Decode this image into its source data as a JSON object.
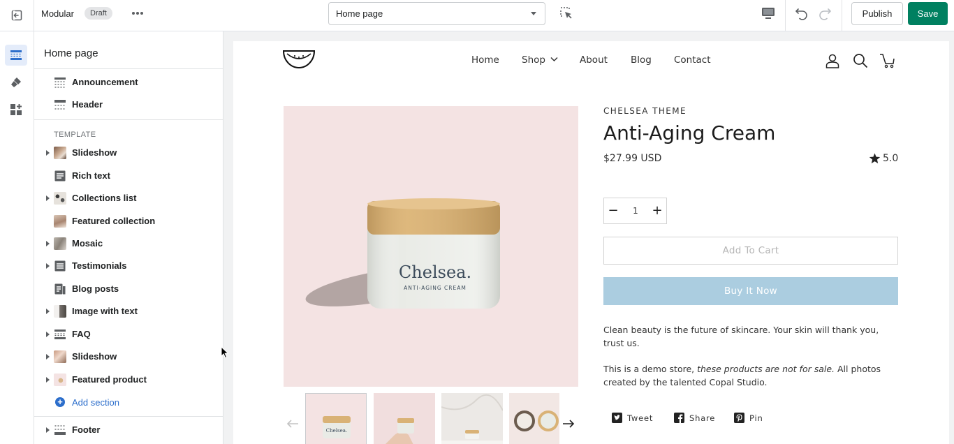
{
  "topbar": {
    "theme_name": "Modular",
    "status_badge": "Draft",
    "page_select": "Home page",
    "publish_label": "Publish",
    "save_label": "Save",
    "save_color": "#008060"
  },
  "rail": {
    "items": [
      {
        "icon": "sections-icon",
        "active": true
      },
      {
        "icon": "theme-settings-icon",
        "active": false
      },
      {
        "icon": "app-embeds-icon",
        "active": false
      }
    ]
  },
  "panel": {
    "title": "Home page",
    "header_sections": [
      {
        "label": "Announcement",
        "icon": "announcement-bar-icon"
      },
      {
        "label": "Header",
        "icon": "header-icon"
      }
    ],
    "template_label": "TEMPLATE",
    "template_sections": [
      {
        "label": "Slideshow",
        "expandable": true,
        "icon": "slideshow-thumb"
      },
      {
        "label": "Rich text",
        "expandable": false,
        "icon": "rich-text-icon"
      },
      {
        "label": "Collections list",
        "expandable": true,
        "icon": "collections-list-thumb"
      },
      {
        "label": "Featured collection",
        "expandable": false,
        "icon": "featured-collection-thumb"
      },
      {
        "label": "Mosaic",
        "expandable": true,
        "icon": "mosaic-thumb"
      },
      {
        "label": "Testimonials",
        "expandable": true,
        "icon": "testimonials-icon"
      },
      {
        "label": "Blog posts",
        "expandable": false,
        "icon": "blog-posts-icon"
      },
      {
        "label": "Image with text",
        "expandable": true,
        "icon": "image-with-text-thumb"
      },
      {
        "label": "FAQ",
        "expandable": true,
        "icon": "faq-icon"
      },
      {
        "label": "Slideshow",
        "expandable": true,
        "icon": "slideshow-thumb"
      },
      {
        "label": "Featured product",
        "expandable": true,
        "icon": "featured-product-thumb"
      }
    ],
    "add_section_label": "Add section",
    "footer_section": {
      "label": "Footer",
      "expandable": true,
      "icon": "footer-icon"
    }
  },
  "store": {
    "nav": [
      "Home",
      "Shop",
      "About",
      "Blog",
      "Contact"
    ],
    "product": {
      "image_text_brand": "Chelsea.",
      "image_text_sub": "ANTI-AGING CREAM",
      "vendor": "CHELSEA THEME",
      "title": "Anti-Aging Cream",
      "price": "$27.99 USD",
      "rating": "5.0",
      "quantity": "1",
      "add_to_cart": "Add To Cart",
      "buy_now": "Buy It Now",
      "buy_now_color": "#abcde0",
      "image_bg_color": "#f4e3e3",
      "description_1": "Clean beauty is the future of skincare. Your skin will thank you, trust us.",
      "description_2_prefix": "This is a demo store, ",
      "description_2_emph": "these products are not for sale.",
      "description_2_suffix": " All photos created by the talented Copal Studio.",
      "share": [
        "Tweet",
        "Share",
        "Pin"
      ]
    }
  }
}
